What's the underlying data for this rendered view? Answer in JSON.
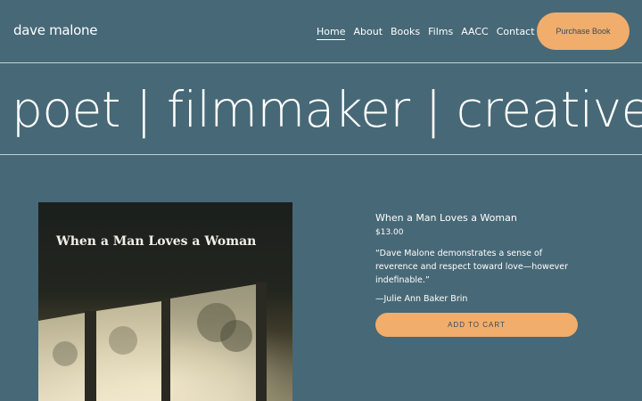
{
  "header": {
    "brand": "dave malone",
    "nav": [
      "Home",
      "About",
      "Books",
      "Films",
      "AACC",
      "Contact"
    ],
    "purchase_label": "Purchase Book"
  },
  "hero": {
    "headline": "poet | filmmaker | creative"
  },
  "book": {
    "cover_title": "When a Man Loves a Woman",
    "title": "When a Man Loves a Woman",
    "price": "$13.00",
    "quote": "“Dave Malone demonstrates a sense of reverence and respect toward love—however indefinable.”",
    "attribution": "—Julie Ann Baker Brin",
    "cart_label": "ADD TO CART"
  },
  "colors": {
    "background": "#476876",
    "accent": "#f0ad6c",
    "text": "#ffffff"
  }
}
